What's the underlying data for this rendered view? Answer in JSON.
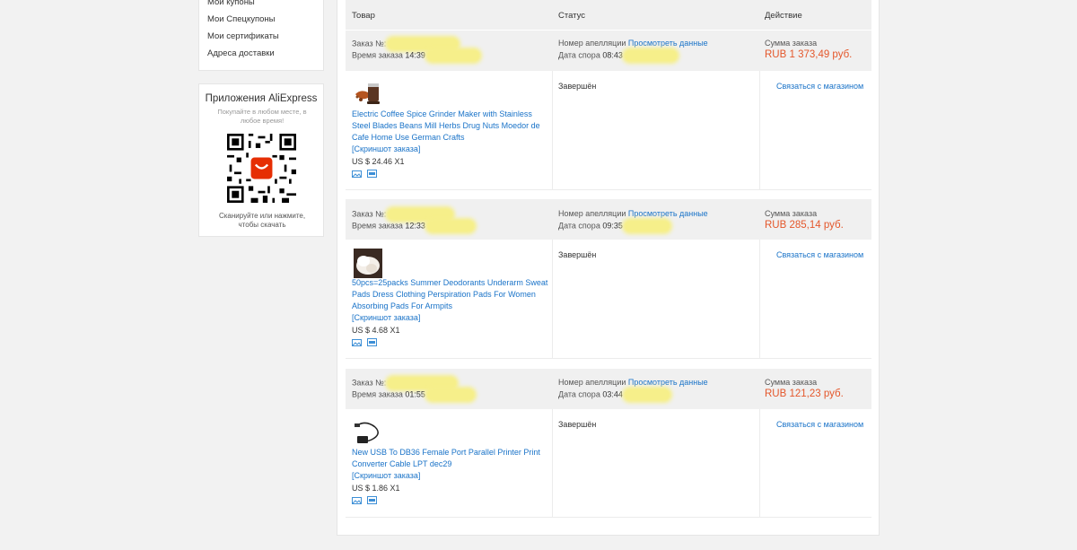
{
  "sidebar": {
    "items": [
      "Мои купоны",
      "Мои Спецкупоны",
      "Мои сертификаты",
      "Адреса доставки"
    ]
  },
  "apps": {
    "title": "Приложения AliExpress",
    "subtitle": "Покупайте в любом месте, в любое время!",
    "scan_text": "Сканируйте или нажмите, чтобы скачать"
  },
  "table": {
    "col_product": "Товар",
    "col_status": "Статус",
    "col_action": "Действие"
  },
  "labels": {
    "order_no": "Заказ №:",
    "order_time": "Время заказа",
    "appeal_no": "Номер апелляции",
    "view_data": "Просмотреть данные",
    "dispute_date": "Дата спора",
    "order_sum": "Сумма заказа",
    "screenshot": "[Скриншот заказа]",
    "contact_store": "Связаться с магазином"
  },
  "orders": [
    {
      "time": "14:39",
      "dispute_time": "08:43",
      "sum": "RUB 1 373,49 руб.",
      "status": "Завершён",
      "product_title": "Electric Coffee Spice Grinder Maker with Stainless Steel Blades Beans Mill Herbs Drug Nuts Moedor de Cafe Home Use German Crafts",
      "price": "US $ 24.46 X1"
    },
    {
      "time": "12:33",
      "dispute_time": "09:35",
      "sum": "RUB 285,14 руб.",
      "status": "Завершён",
      "product_title": "50pcs=25packs Summer Deodorants Underarm Sweat Pads Dress Clothing Perspiration Pads For Women Absorbing Pads For Armpits",
      "price": "US $ 4.68 X1"
    },
    {
      "time": "01:55",
      "dispute_time": "03:44",
      "sum": "RUB 121,23 руб.",
      "status": "Завершён",
      "product_title": "New USB To DB36 Female Port Parallel Printer Print Converter Cable LPT dec29",
      "price": "US $ 1.86 X1"
    }
  ]
}
